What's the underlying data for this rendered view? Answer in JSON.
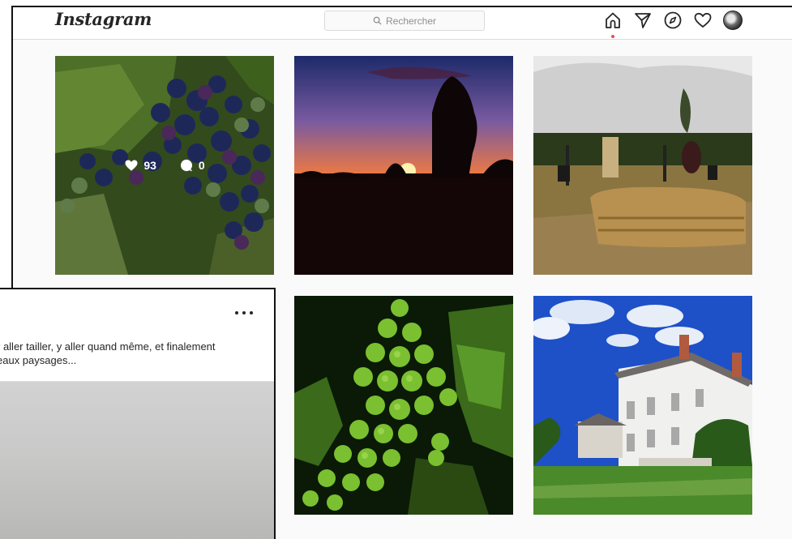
{
  "header": {
    "logo": "Instagram",
    "search_placeholder": "Rechercher",
    "nav_icons": [
      "home-icon",
      "direct-icon",
      "explore-icon",
      "activity-icon",
      "avatar"
    ]
  },
  "grid": {
    "tiles": [
      {
        "subject": "grapes-purple",
        "hover": true,
        "likes": "93",
        "comments": "0"
      },
      {
        "subject": "sunset"
      },
      {
        "subject": "field-hay"
      },
      {
        "subject": "grapes-green"
      },
      {
        "subject": "house"
      }
    ]
  },
  "post": {
    "caption_line1": "r aller tailler, y aller quand même, et finalement",
    "caption_line2": "eaux paysages...",
    "more_icon": "more-icon"
  },
  "colors": {
    "accent_dot": "#ed4956",
    "border": "#dbdbdb"
  }
}
